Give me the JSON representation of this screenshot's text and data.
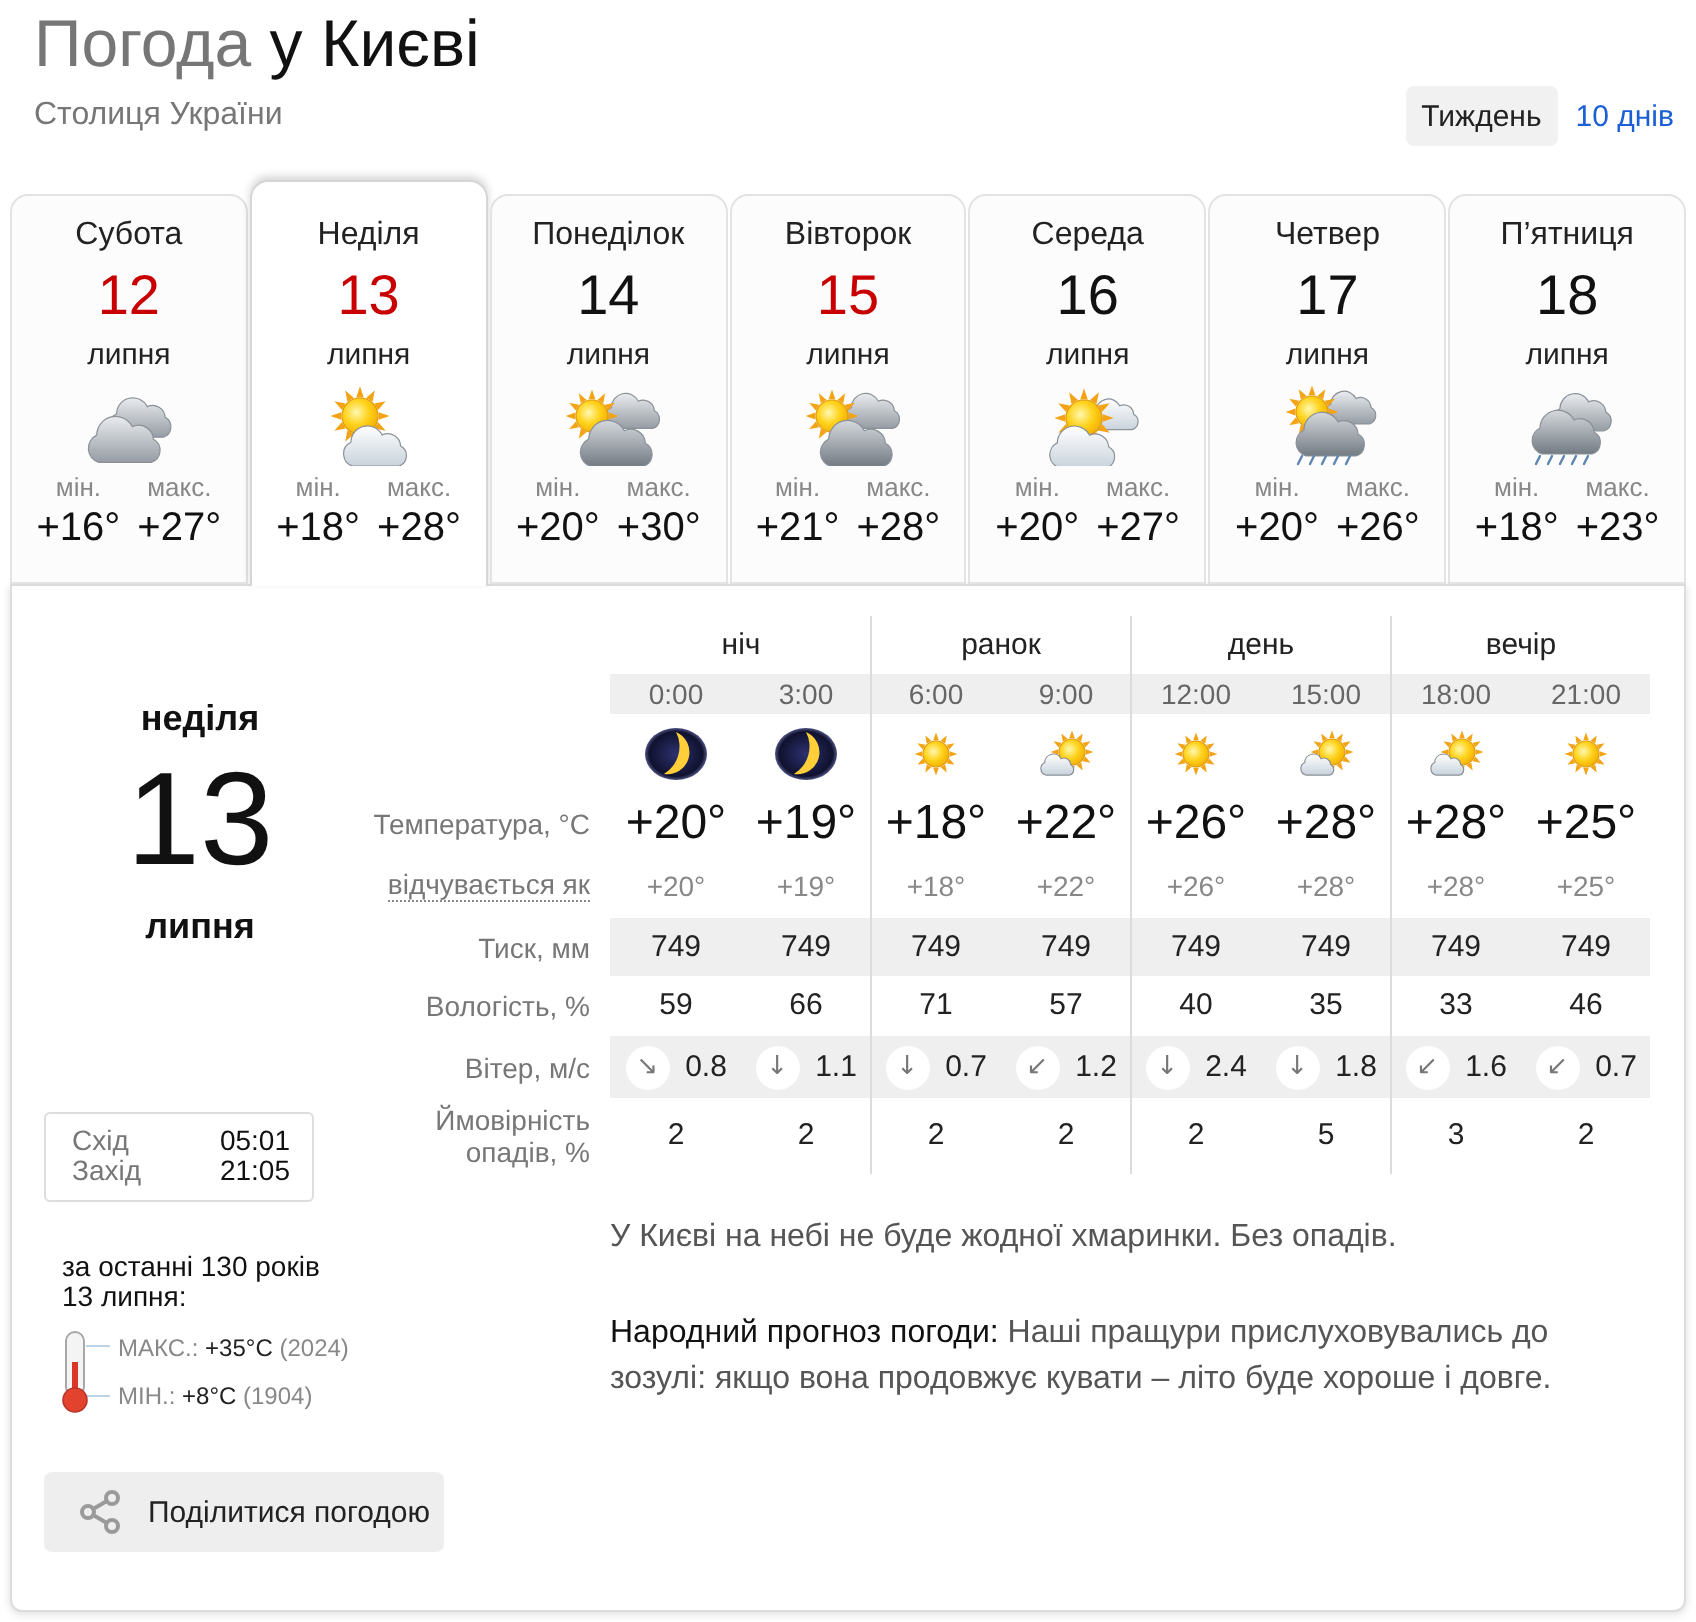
{
  "header": {
    "title_lead": "Погода",
    "title_place": "у Києві",
    "subtitle": "Столиця України"
  },
  "range_tabs": [
    {
      "label": "Тиждень",
      "selected": true
    },
    {
      "label": "10 днів",
      "selected": false
    }
  ],
  "days": [
    {
      "weekday": "Субота",
      "date": "12",
      "month": "липня",
      "holiday": true,
      "kind": "cloudy",
      "min_label": "мін.",
      "min": "+16°",
      "max_label": "макс.",
      "max": "+27°",
      "selected": false
    },
    {
      "weekday": "Неділя",
      "date": "13",
      "month": "липня",
      "holiday": true,
      "kind": "mostly-sunny",
      "min_label": "мін.",
      "min": "+18°",
      "max_label": "макс.",
      "max": "+28°",
      "selected": true
    },
    {
      "weekday": "Понеділок",
      "date": "14",
      "month": "липня",
      "holiday": false,
      "kind": "sun-clouds",
      "min_label": "мін.",
      "min": "+20°",
      "max_label": "макс.",
      "max": "+30°",
      "selected": false
    },
    {
      "weekday": "Вівторок",
      "date": "15",
      "month": "липня",
      "holiday": true,
      "kind": "sun-clouds",
      "min_label": "мін.",
      "min": "+21°",
      "max_label": "макс.",
      "max": "+28°",
      "selected": false
    },
    {
      "weekday": "Середа",
      "date": "16",
      "month": "липня",
      "holiday": false,
      "kind": "partly-cloudy",
      "min_label": "мін.",
      "min": "+20°",
      "max_label": "макс.",
      "max": "+27°",
      "selected": false
    },
    {
      "weekday": "Четвер",
      "date": "17",
      "month": "липня",
      "holiday": false,
      "kind": "sun-rain",
      "min_label": "мін.",
      "min": "+20°",
      "max_label": "макс.",
      "max": "+26°",
      "selected": false
    },
    {
      "weekday": "П’ятниця",
      "date": "18",
      "month": "липня",
      "holiday": false,
      "kind": "rain",
      "min_label": "мін.",
      "min": "+18°",
      "max_label": "макс.",
      "max": "+23°",
      "selected": false
    }
  ],
  "detail": {
    "weekday": "неділя",
    "date": "13",
    "month": "липня",
    "sun": [
      {
        "label": "Схід",
        "time": "05:01"
      },
      {
        "label": "Захід",
        "time": "21:05"
      }
    ],
    "history": [
      "за останні 130 років",
      "13 липня:"
    ],
    "records": [
      {
        "label": "МАКС.:",
        "value": "+35°C",
        "year": "(2024)"
      },
      {
        "label": "МІН.:",
        "value": "+8°C",
        "year": "(1904)"
      }
    ],
    "share_button": "Поділитися погодою"
  },
  "hourly": {
    "periods": [
      "ніч",
      "ранок",
      "день",
      "вечір"
    ],
    "rows": [
      {
        "kind": "temp",
        "label": "Температура, °C"
      },
      {
        "kind": "feels",
        "label": "відчувається як"
      },
      {
        "kind": "pressure",
        "label": "Тиск, мм"
      },
      {
        "kind": "humidity",
        "label": "Вологість, %"
      },
      {
        "kind": "wind",
        "label": "Вітер, м/с"
      },
      {
        "kind": "precip",
        "label": "Ймовірність опадів, %"
      }
    ],
    "hours": [
      {
        "time": "0:00",
        "kind": "moon",
        "temp": "+20°",
        "feels": "+20°",
        "pressure": "749",
        "humidity": "59",
        "wind_arrow": "↘",
        "wind": "0.8",
        "precip": "2"
      },
      {
        "time": "3:00",
        "kind": "moon",
        "temp": "+19°",
        "feels": "+19°",
        "pressure": "749",
        "humidity": "66",
        "wind_arrow": "↓",
        "wind": "1.1",
        "precip": "2"
      },
      {
        "time": "6:00",
        "kind": "sun",
        "temp": "+18°",
        "feels": "+18°",
        "pressure": "749",
        "humidity": "71",
        "wind_arrow": "↓",
        "wind": "0.7",
        "precip": "2"
      },
      {
        "time": "9:00",
        "kind": "sun-cloud",
        "temp": "+22°",
        "feels": "+22°",
        "pressure": "749",
        "humidity": "57",
        "wind_arrow": "↙",
        "wind": "1.2",
        "precip": "2"
      },
      {
        "time": "12:00",
        "kind": "sun",
        "temp": "+26°",
        "feels": "+26°",
        "pressure": "749",
        "humidity": "40",
        "wind_arrow": "↓",
        "wind": "2.4",
        "precip": "2"
      },
      {
        "time": "15:00",
        "kind": "sun-cloud",
        "temp": "+28°",
        "feels": "+28°",
        "pressure": "749",
        "humidity": "35",
        "wind_arrow": "↓",
        "wind": "1.8",
        "precip": "5"
      },
      {
        "time": "18:00",
        "kind": "sun-cloud",
        "temp": "+28°",
        "feels": "+28°",
        "pressure": "749",
        "humidity": "33",
        "wind_arrow": "↙",
        "wind": "1.6",
        "precip": "3"
      },
      {
        "time": "21:00",
        "kind": "sun",
        "temp": "+25°",
        "feels": "+25°",
        "pressure": "749",
        "humidity": "46",
        "wind_arrow": "↙",
        "wind": "0.7",
        "precip": "2"
      }
    ]
  },
  "summary": "У Києві на небі не буде жодної хмаринки. Без опадів.",
  "folk": {
    "label": "Народний прогноз погоди:",
    "text": "Наші пращури прислуховувались до зозулі: якщо вона продовжує кувати – літо буде хороше і довге."
  }
}
